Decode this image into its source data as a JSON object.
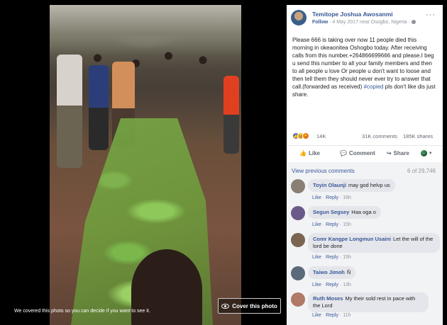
{
  "photo": {
    "notice": "We covered this photo so you can decide if you want to see it.",
    "cover_button": "Cover this photo"
  },
  "post": {
    "author": "Temitope Joshua Awosanmi",
    "follow": "Follow",
    "meta": " · 4 May 2017 near Osogbo, Nigeria · ",
    "more_icon": "···",
    "text": "Please 666 is taking over now 11 people died this morning in okeaonitea Oshogbo today. After receiving calls from this number.+264866699666 and please.I beg u send this number to all your family members and then to all people u love Or people u don't want to loose and then tell them they should never ever try to answer that call.(forwarded as received) ",
    "hashtag": "#copied",
    "text_end": " pls don't like dis just share.",
    "reaction_count": "14K",
    "comments_count": "31K comments",
    "shares_count": "185K shares",
    "actions": {
      "like": "Like",
      "comment": "Comment",
      "share": "Share"
    }
  },
  "comments": {
    "view_previous": "View previous comments",
    "count": "6 of 29,746",
    "items": [
      {
        "name": "Toyin Olaunji",
        "text": "may god helvp us",
        "like": "Like",
        "reply": "Reply",
        "time": "16h",
        "avatar_color": "#8a7f74"
      },
      {
        "name": "Segun Segsey",
        "text": "Haa oga o",
        "like": "Like",
        "reply": "Reply",
        "time": "15h",
        "avatar_color": "#6a5a8a"
      },
      {
        "name": "Comr Kangpe Longmun Usaini",
        "text": "Let the will of the lord be done",
        "like": "Like",
        "reply": "Reply",
        "time": "15h",
        "avatar_color": "#7a6650"
      },
      {
        "name": "Taiwo Jimoh",
        "text": "Ñ",
        "like": "Like",
        "reply": "Reply",
        "time": "13h",
        "avatar_color": "#5a6a7a"
      },
      {
        "name": "Ruth Moses",
        "text": "My their sold rest in pace with the Lord",
        "like": "Like",
        "reply": "Reply",
        "time": "11h",
        "avatar_color": "#b07a66"
      }
    ],
    "separator": " · "
  }
}
